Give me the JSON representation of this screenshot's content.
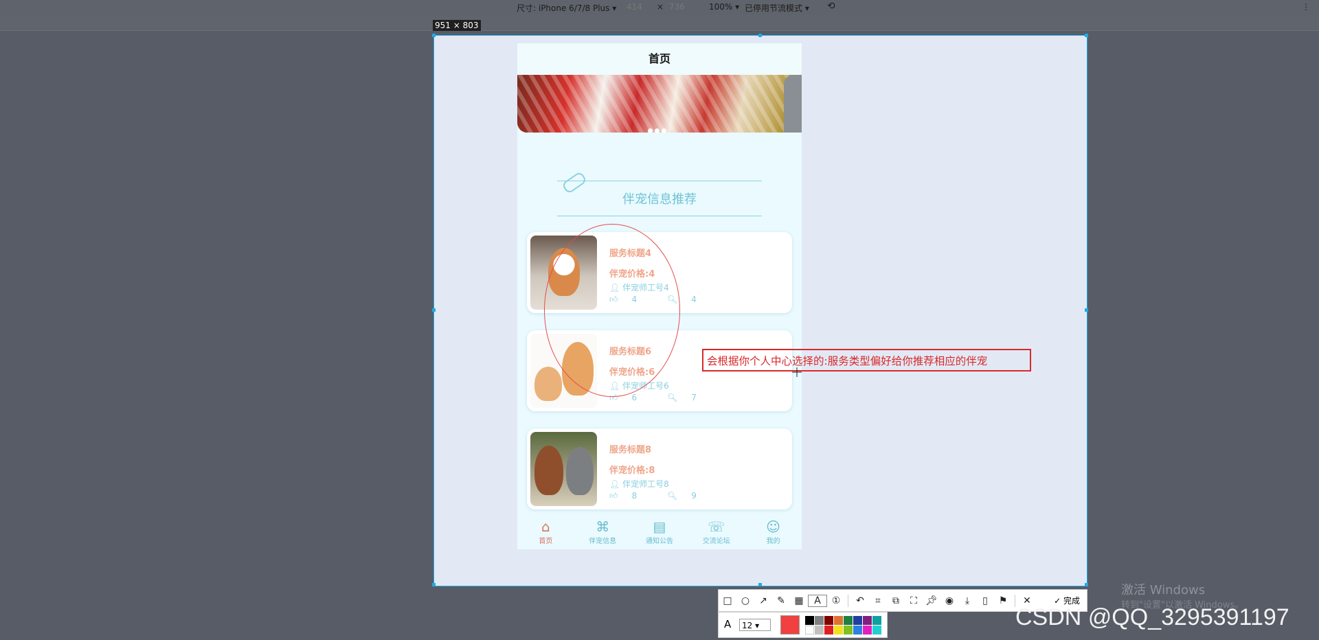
{
  "devtools": {
    "size_label": "尺寸: iPhone 6/7/8 Plus ▾",
    "width": "414",
    "times": "×",
    "height": "736",
    "zoom": "100% ▾",
    "throttle": "已停用节流模式 ▾",
    "size_tag": "951 × 803"
  },
  "phone": {
    "header_title": "首页",
    "section_title": "伴宠信息推荐",
    "cards": [
      {
        "title": "服务标题4",
        "price": "伴宠价格:4",
        "staff": "伴宠师工号4",
        "likes": "4",
        "views": "4"
      },
      {
        "title": "服务标题6",
        "price": "伴宠价格:6",
        "staff": "伴宠师工号6",
        "likes": "6",
        "views": "7"
      },
      {
        "title": "服务标题8",
        "price": "伴宠价格:8",
        "staff": "伴宠师工号8",
        "likes": "8",
        "views": "9"
      }
    ],
    "tabs": [
      {
        "label": "首页",
        "icon": "home-icon"
      },
      {
        "label": "伴宠信息",
        "icon": "grid-icon"
      },
      {
        "label": "通知公告",
        "icon": "news-icon"
      },
      {
        "label": "交流论坛",
        "icon": "chat-icon"
      },
      {
        "label": "我的",
        "icon": "user-icon"
      }
    ]
  },
  "annotation": {
    "text": "会根据你个人中心选择的:服务类型偏好给你推荐相应的伴宠"
  },
  "snip": {
    "done_label": "完成",
    "font_size": "12",
    "current_color": "#f04040"
  },
  "watermarks": {
    "activate": "激活 Windows",
    "activate_sub": "转到\"设置\"以激活 Windows。",
    "csdn": "CSDN @QQ_3295391197"
  }
}
